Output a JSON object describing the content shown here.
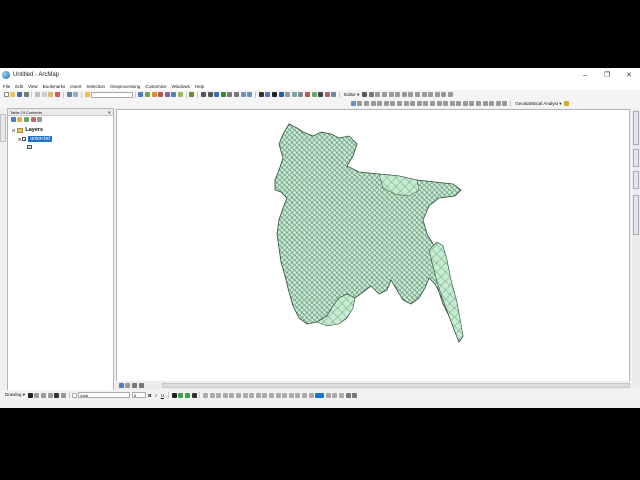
{
  "window": {
    "title": "Untitled - ArcMap"
  },
  "menu": [
    "File",
    "Edit",
    "View",
    "Bookmarks",
    "Insert",
    "Selection",
    "Geoprocessing",
    "Customize",
    "Windows",
    "Help"
  ],
  "toolbar": {
    "scale_value": "",
    "editor_label": "Editor ▾",
    "geostat_label": "Geostatistical Analyst ▾"
  },
  "toc": {
    "title": "Table Of Contents",
    "close_glyph": "✕",
    "root_label": "Layers",
    "layer_name": "union-bd",
    "layer_checked": "✓"
  },
  "drawing": {
    "label": "Drawing ▾",
    "font_name": "Arial",
    "font_size": "8",
    "bold": "B",
    "italic": "I",
    "underline": "U"
  },
  "colors": {
    "polygon_fill": "#c4ecd0",
    "polygon_edge": "#2f4d3a",
    "selection": "#1e73c8"
  }
}
